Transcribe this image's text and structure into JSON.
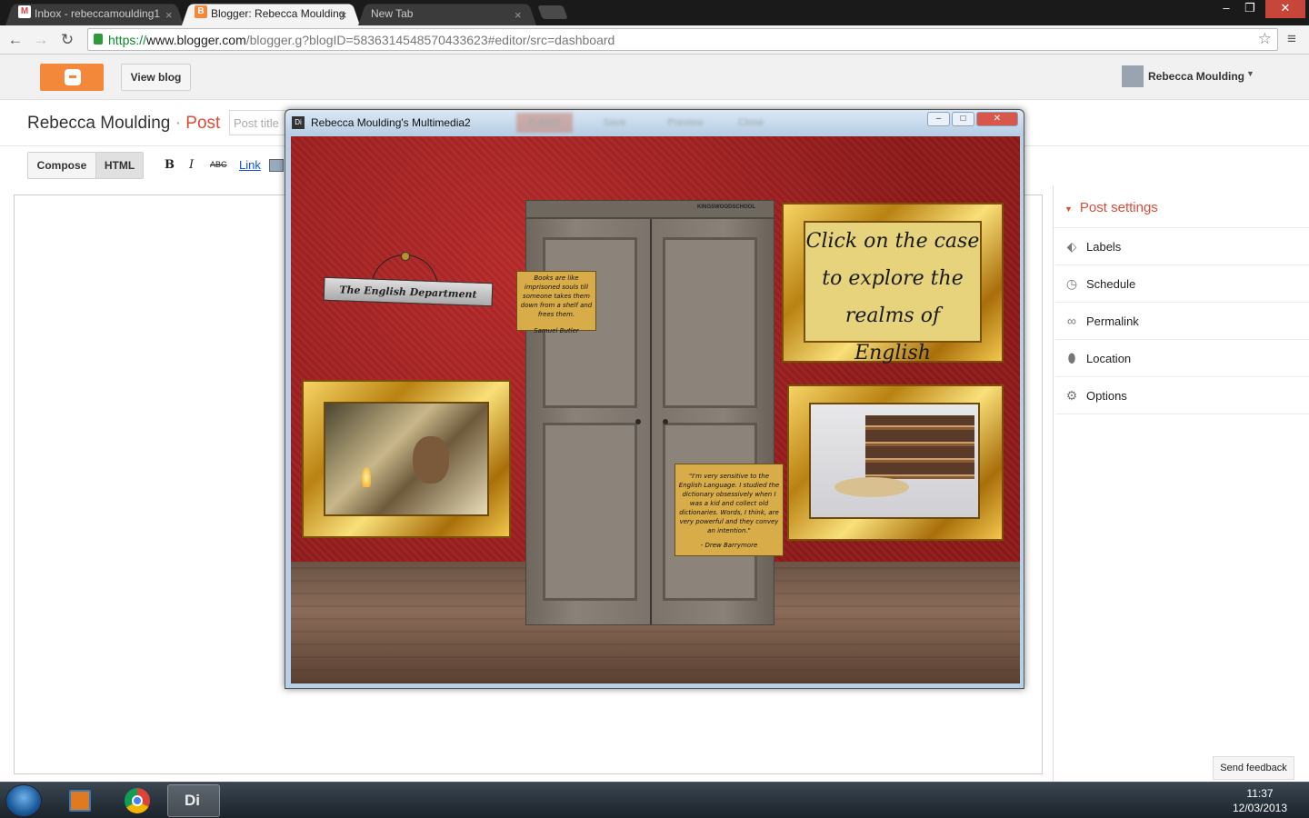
{
  "browser": {
    "tabs": [
      {
        "label": "Inbox - rebeccamoulding1",
        "close": "×"
      },
      {
        "label": "Blogger: Rebecca Moulding",
        "close": "×"
      },
      {
        "label": "New Tab",
        "close": "×"
      }
    ],
    "url_scheme": "https://",
    "url_domain": "www.blogger.com",
    "url_path": "/blogger.g?blogID=5836314548570433623#editor/src=dashboard",
    "window_controls": [
      "–",
      "❐",
      "✕"
    ]
  },
  "blogger": {
    "view_blog_label": "View blog",
    "user_name": "Rebecca Moulding",
    "blog_name": "Rebecca Moulding",
    "separator": " · ",
    "post_label": "Post",
    "post_title_placeholder": "Post title",
    "compose_label": "Compose",
    "html_label": "HTML",
    "bold_label": "B",
    "italic_label": "I",
    "strike_label": "ABC",
    "link_label": "Link"
  },
  "sidebar": {
    "header": "Post settings",
    "items": [
      {
        "label": "Labels",
        "icon": "tag-icon"
      },
      {
        "label": "Schedule",
        "icon": "clock-icon"
      },
      {
        "label": "Permalink",
        "icon": "link-icon"
      },
      {
        "label": "Location",
        "icon": "pin-icon"
      },
      {
        "label": "Options",
        "icon": "gear-icon"
      }
    ],
    "feedback_label": "Send feedback"
  },
  "di_window": {
    "title": "Rebecca Moulding's Multimedia2",
    "icon_label": "Di",
    "ghost_buttons": [
      "Publish",
      "Save",
      "Preview",
      "Close"
    ],
    "sign_text": "The English Department",
    "quote1": "Books are like imprisoned souls till someone takes them down from a shelf and frees them.",
    "quote1_author": "Samuel Butler",
    "quote2": "\"I'm very sensitive to the English Language. I studied the dictionary obsessively when I was a kid and collect old dictionaries. Words, I think, are very powerful and they convey an intention.\"",
    "quote2_author": "- Drew Barrymore",
    "click_text": "Click on the case to explore the realms of English",
    "watermark": "KINGSWOODSCHOOL"
  },
  "taskbar": {
    "di_label": "Di",
    "time": "11:37",
    "date": "12/03/2013"
  },
  "colors": {
    "accent": "#dd4b39",
    "blogger_orange": "#f4883a",
    "wall_red": "#9b1f1f"
  }
}
